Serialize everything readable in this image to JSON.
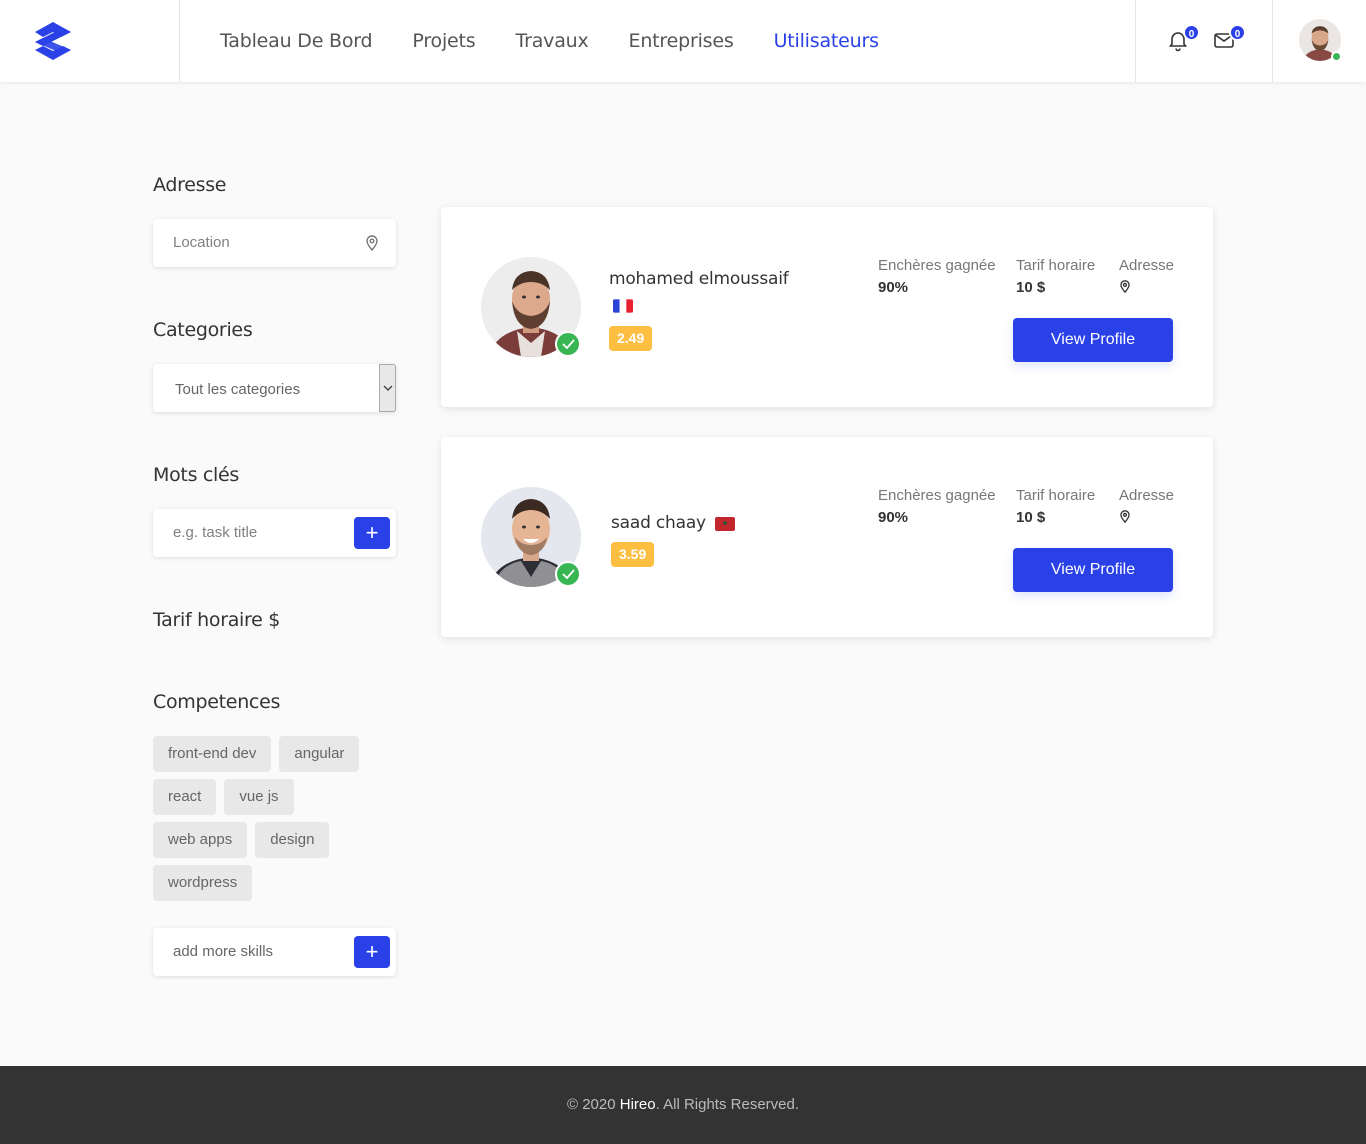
{
  "header": {
    "nav": [
      "Tableau De Bord",
      "Projets",
      "Travaux",
      "Entreprises",
      "Utilisateurs"
    ],
    "active_nav": "Utilisateurs",
    "notifications_count": "0",
    "messages_count": "0",
    "accent_color": "#2a41e8"
  },
  "sidebar": {
    "address_title": "Adresse",
    "location_placeholder": "Location",
    "categories_title": "Categories",
    "category_selected": "Tout les categories",
    "keywords_title": "Mots clés",
    "keywords_placeholder": "e.g. task title",
    "rate_title": "Tarif horaire $",
    "skills_title": "Competences",
    "skills": [
      "front-end dev",
      "angular",
      "react",
      "vue js",
      "web apps",
      "design",
      "wordpress"
    ],
    "add_skills_placeholder": "add more skills",
    "add_button_label": "+"
  },
  "freelancers": [
    {
      "name": "mohamed elmoussaif",
      "flag": "france",
      "rating": "2.49",
      "won_label": "Enchères gagnée",
      "won_value": "90%",
      "rate_label": "Tarif horaire",
      "rate_value": "10 $",
      "address_label": "Adresse",
      "button_label": "View Profile"
    },
    {
      "name": "saad chaay",
      "flag": "morocco",
      "rating": "3.59",
      "won_label": "Enchères gagnée",
      "won_value": "90%",
      "rate_label": "Tarif horaire",
      "rate_value": "10 $",
      "address_label": "Adresse",
      "button_label": "View Profile"
    }
  ],
  "footer": {
    "prefix": "© 2020 ",
    "brand": "Hireo",
    "suffix": ". All Rights Reserved."
  }
}
